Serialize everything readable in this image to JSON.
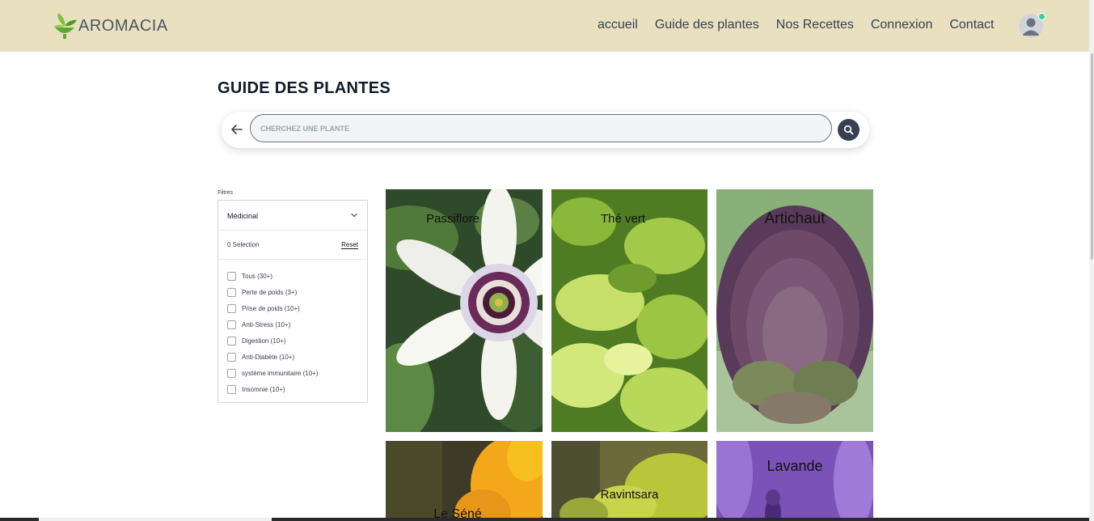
{
  "brand": {
    "name": "AROMACIA"
  },
  "nav": {
    "items": [
      "accueil",
      "Guide des plantes",
      "Nos Recettes",
      "Connexion",
      "Contact"
    ]
  },
  "page": {
    "title": "GUIDE DES PLANTES"
  },
  "search": {
    "placeholder": "CHERCHEZ UNE PLANTE",
    "value": ""
  },
  "filters": {
    "label": "Filtres",
    "selected_category": "Médicinal",
    "selection_count": "0 Selection",
    "reset_label": "Reset",
    "options": [
      "Tous (30+)",
      "Perte de poids (3+)",
      "Prise de poids (10+)",
      "Anti-Stress (10+)",
      "Digestion (10+)",
      "Anti-Diabète (10+)",
      "système immunitaire (10+)",
      "Insomnie (10+)"
    ]
  },
  "plants": [
    "Passiflore",
    "Thé vert",
    "Artichaut",
    "Le Séné",
    "Ravintsara",
    "Lavande"
  ],
  "colors": {
    "header_bg": "#e9e0c0",
    "accent_green": "#6abf3b",
    "search_btn": "#374151",
    "online_dot": "#34d399"
  }
}
